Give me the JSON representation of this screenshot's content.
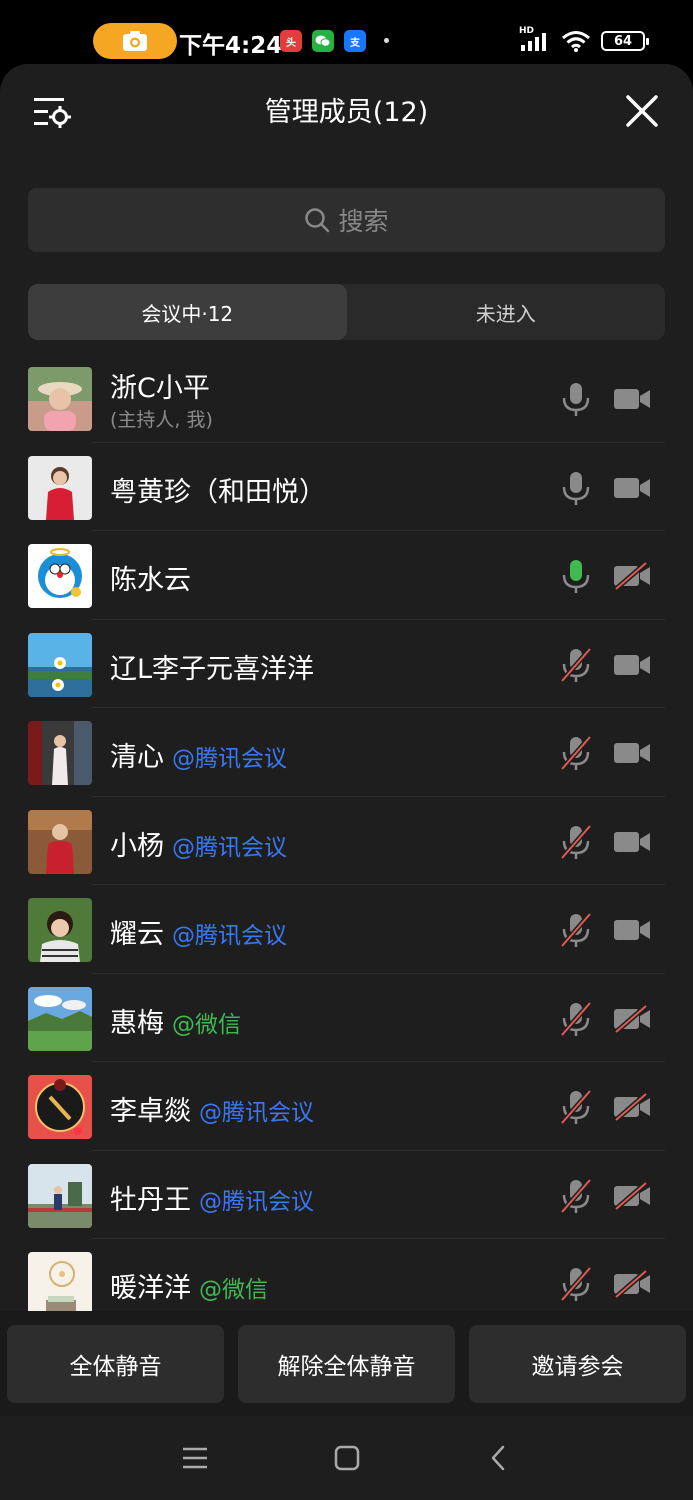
{
  "status_bar": {
    "time": "下午4:24",
    "battery": "64",
    "network_tag": "HD",
    "app_icons": [
      "toutiao-icon",
      "wechat-icon",
      "alipay-icon"
    ]
  },
  "header": {
    "title": "管理成员(12)"
  },
  "search": {
    "placeholder": "搜索"
  },
  "tabs": [
    {
      "label": "会议中·12",
      "active": true
    },
    {
      "label": "未进入",
      "active": false
    }
  ],
  "members": [
    {
      "name": "浙C小平",
      "subtitle": "(主持人, 我)",
      "source": "",
      "mic": "on",
      "camera": "on"
    },
    {
      "name": "粤黄珍（和田悦）",
      "subtitle": "",
      "source": "",
      "mic": "on",
      "camera": "on"
    },
    {
      "name": "陈水云",
      "subtitle": "",
      "source": "",
      "mic": "active",
      "camera": "off"
    },
    {
      "name": "辽L李子元喜洋洋",
      "subtitle": "",
      "source": "",
      "mic": "muted",
      "camera": "on"
    },
    {
      "name": "清心",
      "subtitle": "",
      "source": "@腾讯会议",
      "mic": "muted",
      "camera": "on"
    },
    {
      "name": "小杨",
      "subtitle": "",
      "source": "@腾讯会议",
      "mic": "muted",
      "camera": "on"
    },
    {
      "name": "耀云",
      "subtitle": "",
      "source": "@腾讯会议",
      "mic": "muted",
      "camera": "on"
    },
    {
      "name": "惠梅",
      "subtitle": "",
      "source": "@微信",
      "mic": "muted",
      "camera": "off"
    },
    {
      "name": "李卓燚",
      "subtitle": "",
      "source": "@腾讯会议",
      "mic": "muted",
      "camera": "off"
    },
    {
      "name": "牡丹王",
      "subtitle": "",
      "source": "@腾讯会议",
      "mic": "muted",
      "camera": "off"
    },
    {
      "name": "暖洋洋",
      "subtitle": "",
      "source": "@微信",
      "mic": "muted",
      "camera": "off"
    }
  ],
  "actions": {
    "mute_all": "全体静音",
    "unmute_all": "解除全体静音",
    "invite": "邀请参会"
  },
  "colors": {
    "sheet_bg": "#1e1e1e",
    "tencent_source": "#3a78f2",
    "wechat_source": "#3fb950",
    "mic_active": "#3fb950",
    "muted_slash": "#e05a4f",
    "record_pill": "#f5a623"
  }
}
